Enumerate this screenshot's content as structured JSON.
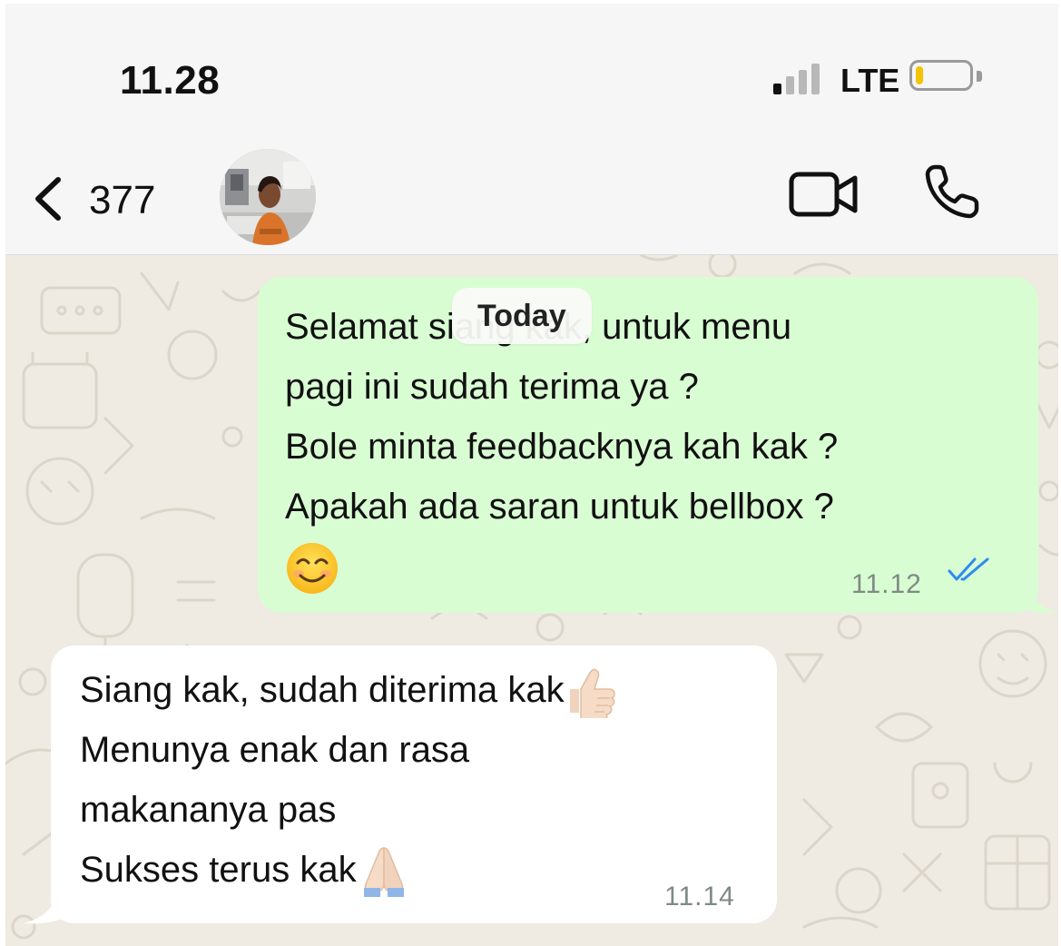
{
  "status_bar": {
    "time": "11.28",
    "network": "LTE",
    "signal_bars_filled": 1,
    "signal_bars_total": 4,
    "battery_level": 0.15,
    "battery_color": "#f5c400"
  },
  "header": {
    "back_count": "377",
    "back_icon": "chevron-left-icon",
    "video_icon": "video-camera-icon",
    "call_icon": "phone-icon"
  },
  "chat": {
    "date_chip": "Today",
    "messages": [
      {
        "direction": "outgoing",
        "lines": [
          "Selamat siang kak, untuk menu",
          "pagi ini sudah terima ya ?",
          "Bole minta feedbacknya kah kak ?",
          "Apakah ada saran untuk bellbox ?"
        ],
        "emoji": "😊",
        "time": "11.12",
        "status": "read",
        "status_icon": "double-check-icon",
        "status_color": "#2d8cf0"
      },
      {
        "direction": "incoming",
        "lines": [
          "Siang kak, sudah diterima kak",
          "Menunya enak dan rasa",
          "makananya pas",
          "Sukses terus kak"
        ],
        "line_emojis": [
          "👍🏻",
          "",
          "",
          "🙏🏻"
        ],
        "time": "11.14"
      }
    ]
  },
  "colors": {
    "outgoing_bubble": "#d9fdd3",
    "incoming_bubble": "#ffffff",
    "wallpaper": "#efeae2",
    "header_bg": "#f6f6f6"
  }
}
